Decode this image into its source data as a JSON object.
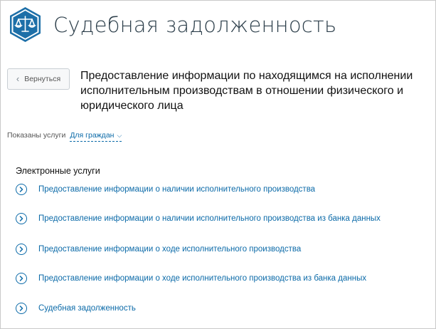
{
  "header": {
    "title": "Судебная задолженность",
    "logo_icon": "scales-icon"
  },
  "back_button": {
    "label": "Вернуться",
    "icon": "chevron-left-icon"
  },
  "page_title": "Предоставление информации по находящимся на исполнении исполнительным производствам в отношении физического и юридического лица",
  "filter": {
    "label": "Показаны услуги",
    "selected": "Для граждан",
    "icon": "chevron-down-icon"
  },
  "section": {
    "title": "Электронные услуги",
    "items": [
      {
        "label": "Предоставление информации о наличии исполнительного производства"
      },
      {
        "label": "Предоставление информации о наличии исполнительного производства из банка данных"
      },
      {
        "label": "Предоставление информации о ходе исполнительного производства"
      },
      {
        "label": "Предоставление информации о ходе исполнительного производства из банка данных"
      },
      {
        "label": "Судебная задолженность"
      }
    ]
  },
  "colors": {
    "accent": "#0b6aa8",
    "title": "#2c3e4a"
  }
}
